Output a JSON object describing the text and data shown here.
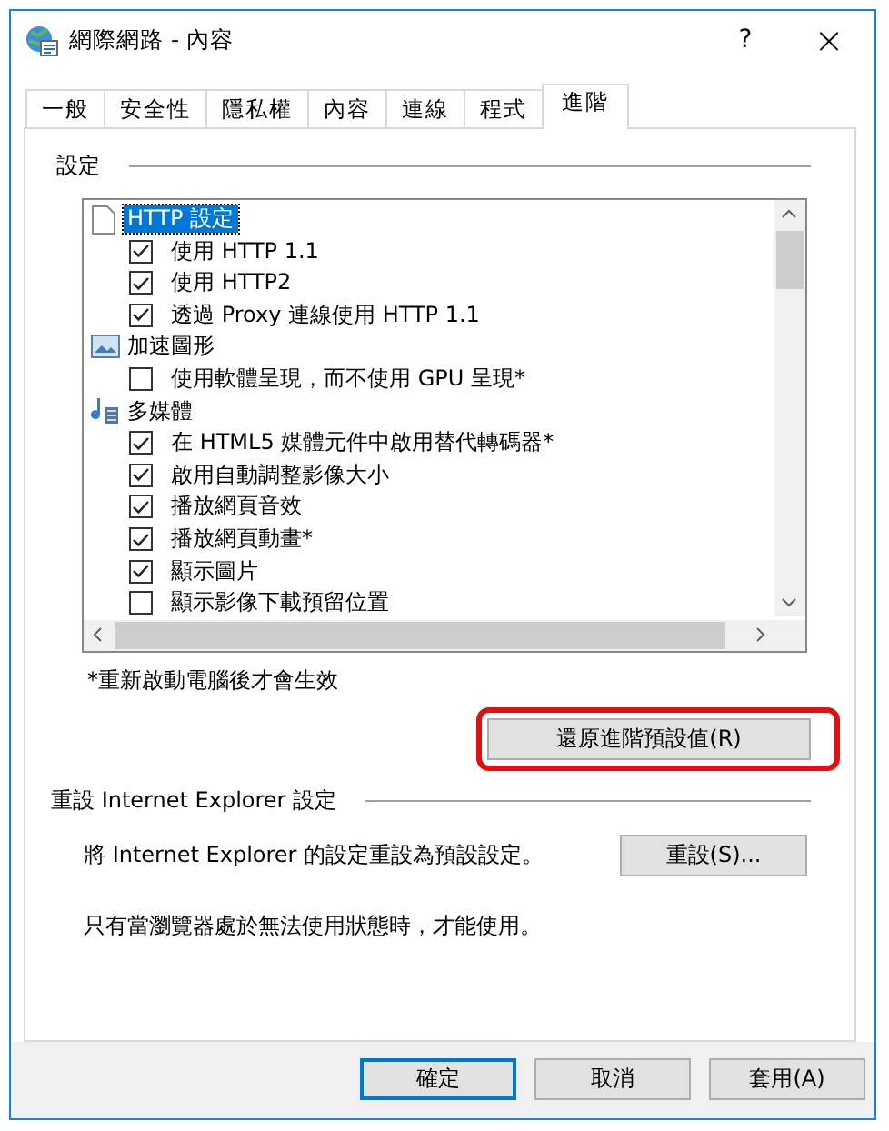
{
  "window": {
    "title": "網際網路 - 內容",
    "help": "?",
    "close": "×"
  },
  "tabs": [
    {
      "label": "一般",
      "selected": false
    },
    {
      "label": "安全性",
      "selected": false
    },
    {
      "label": "隱私權",
      "selected": false
    },
    {
      "label": "內容",
      "selected": false
    },
    {
      "label": "連線",
      "selected": false
    },
    {
      "label": "程式",
      "selected": false
    },
    {
      "label": "進階",
      "selected": true
    }
  ],
  "settings_group": {
    "title": "設定",
    "tree": [
      {
        "label": "HTTP 設定",
        "kind": "page",
        "selected": true,
        "children": [
          {
            "label": "使用 HTTP 1.1",
            "checked": true
          },
          {
            "label": "使用 HTTP2",
            "checked": true
          },
          {
            "label": "透過 Proxy 連線使用 HTTP 1.1",
            "checked": true
          }
        ]
      },
      {
        "label": "加速圖形",
        "kind": "image",
        "selected": false,
        "children": [
          {
            "label": "使用軟體呈現，而不使用 GPU 呈現*",
            "checked": false
          }
        ]
      },
      {
        "label": "多媒體",
        "kind": "media",
        "selected": false,
        "children": [
          {
            "label": "在 HTML5 媒體元件中啟用替代轉碼器*",
            "checked": true
          },
          {
            "label": "啟用自動調整影像大小",
            "checked": true
          },
          {
            "label": "播放網頁音效",
            "checked": true
          },
          {
            "label": "播放網頁動畫*",
            "checked": true
          },
          {
            "label": "顯示圖片",
            "checked": true
          },
          {
            "label": "顯示影像下載預留位置",
            "checked": false
          }
        ]
      }
    ],
    "note": "*重新啟動電腦後才會生效",
    "restore_button": {
      "label": "還原進階預設值(R)",
      "highlighted": true
    }
  },
  "reset_group": {
    "title": "重設 Internet Explorer 設定",
    "description": "將 Internet Explorer 的設定重設為預設設定。",
    "reset_button": "重設(S)...",
    "note": "只有當瀏覽器處於無法使用狀態時，才能使用。"
  },
  "buttons": [
    {
      "label": "確定",
      "default": true
    },
    {
      "label": "取消",
      "default": false
    },
    {
      "label": "套用(A)",
      "default": false
    }
  ]
}
